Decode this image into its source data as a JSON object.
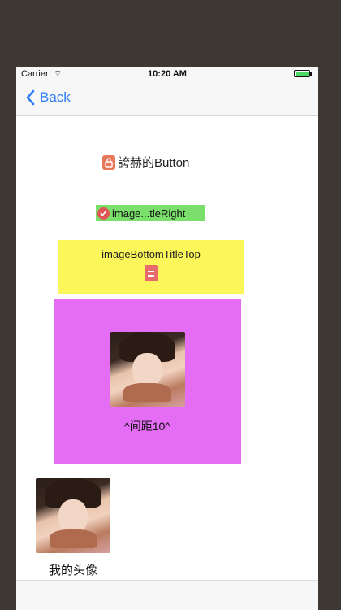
{
  "status_bar": {
    "carrier": "Carrier",
    "time": "10:20 AM"
  },
  "nav": {
    "back_label": "Back"
  },
  "buttons": {
    "btn1_label": "誇赫的Button",
    "btn2_label": "image...tleRight",
    "btn3_label": "imageBottomTitleTop",
    "btn4_label": "^间距10^"
  },
  "profile": {
    "name": "我的头像"
  },
  "colors": {
    "nav_tint": "#2f7cf6",
    "green_button": "#7be06b",
    "yellow_button": "#fbf65a",
    "magenta_button": "#e56df5",
    "battery": "#4cd964"
  },
  "icons": {
    "btn1": "lock-icon",
    "btn2": "check-circle-icon",
    "btn3": "document-icon",
    "back": "chevron-left-icon"
  }
}
